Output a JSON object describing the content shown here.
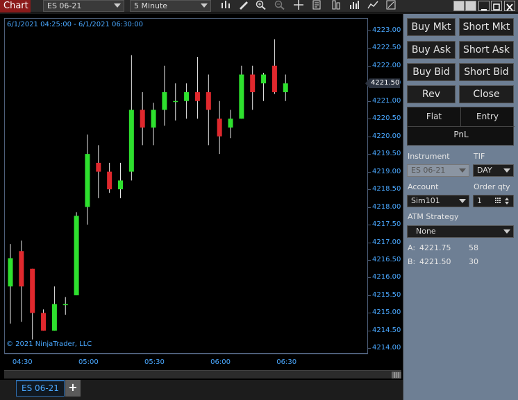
{
  "toolbar": {
    "chart_tab": "Chart",
    "instrument": "ES 06-21",
    "interval": "5 Minute",
    "icons": [
      "bars-type-icon",
      "drawing-tool-icon",
      "zoom-in-icon",
      "zoom-out-icon",
      "crosshair-icon",
      "properties-icon",
      "strategies-icon",
      "indicators-icon",
      "chart-trader-icon",
      "snapshot-icon"
    ]
  },
  "chart": {
    "range_label": "6/1/2021 04:25:00 - 6/1/2021 06:30:00",
    "copyright": "© 2021 NinjaTrader, LLC",
    "current_price": "4221.50",
    "y_ticks": [
      "4223.00",
      "4222.50",
      "4222.00",
      "4221.50",
      "4221.00",
      "4220.50",
      "4220.00",
      "4219.50",
      "4219.00",
      "4218.50",
      "4218.00",
      "4217.50",
      "4217.00",
      "4216.50",
      "4216.00",
      "4215.50",
      "4215.00",
      "4214.50",
      "4214.00"
    ],
    "x_ticks": [
      "04:30",
      "05:00",
      "05:30",
      "06:00",
      "06:30"
    ],
    "colors": {
      "up": "#2ee02e",
      "down": "#e0282d",
      "wick": "#e8e8e8",
      "axis_text": "#4aa8ff"
    }
  },
  "chart_data": {
    "type": "candlestick",
    "x": [
      "04:25",
      "04:30",
      "04:35",
      "04:40",
      "04:45",
      "04:50",
      "04:55",
      "05:00",
      "05:05",
      "05:10",
      "05:15",
      "05:20",
      "05:25",
      "05:30",
      "05:35",
      "05:40",
      "05:45",
      "05:50",
      "05:55",
      "06:00",
      "06:05",
      "06:10",
      "06:15",
      "06:20",
      "06:25",
      "06:30"
    ],
    "ohlc": [
      {
        "o": 4215.75,
        "h": 4216.95,
        "l": 4214.7,
        "c": 4216.55
      },
      {
        "o": 4216.75,
        "h": 4217.05,
        "l": 4214.75,
        "c": 4215.75
      },
      {
        "o": 4216.25,
        "h": 4216.25,
        "l": 4214.25,
        "c": 4215.0
      },
      {
        "o": 4215.0,
        "h": 4215.1,
        "l": 4214.5,
        "c": 4214.5
      },
      {
        "o": 4214.5,
        "h": 4215.75,
        "l": 4214.5,
        "c": 4215.25
      },
      {
        "o": 4215.25,
        "h": 4215.45,
        "l": 4214.95,
        "c": 4215.25
      },
      {
        "o": 4215.5,
        "h": 4217.85,
        "l": 4215.5,
        "c": 4217.75
      },
      {
        "o": 4218.0,
        "h": 4220.05,
        "l": 4217.5,
        "c": 4219.5
      },
      {
        "o": 4219.25,
        "h": 4219.75,
        "l": 4218.25,
        "c": 4219.0
      },
      {
        "o": 4219.0,
        "h": 4219.25,
        "l": 4218.4,
        "c": 4218.5
      },
      {
        "o": 4218.5,
        "h": 4219.25,
        "l": 4218.25,
        "c": 4218.75
      },
      {
        "o": 4219.0,
        "h": 4222.3,
        "l": 4218.75,
        "c": 4220.75
      },
      {
        "o": 4220.75,
        "h": 4221.25,
        "l": 4219.75,
        "c": 4220.25
      },
      {
        "o": 4220.25,
        "h": 4220.95,
        "l": 4219.75,
        "c": 4220.75
      },
      {
        "o": 4220.75,
        "h": 4222.0,
        "l": 4220.3,
        "c": 4221.25
      },
      {
        "o": 4221.0,
        "h": 4221.5,
        "l": 4220.45,
        "c": 4221.0
      },
      {
        "o": 4221.0,
        "h": 4221.5,
        "l": 4220.5,
        "c": 4221.25
      },
      {
        "o": 4221.25,
        "h": 4222.25,
        "l": 4220.5,
        "c": 4221.0
      },
      {
        "o": 4221.25,
        "h": 4221.75,
        "l": 4219.75,
        "c": 4220.75
      },
      {
        "o": 4220.5,
        "h": 4221.0,
        "l": 4219.5,
        "c": 4220.0
      },
      {
        "o": 4220.25,
        "h": 4220.75,
        "l": 4219.95,
        "c": 4220.5
      },
      {
        "o": 4220.5,
        "h": 4222.0,
        "l": 4220.5,
        "c": 4221.75
      },
      {
        "o": 4221.75,
        "h": 4222.0,
        "l": 4220.75,
        "c": 4221.25
      },
      {
        "o": 4221.5,
        "h": 4221.8,
        "l": 4221.0,
        "c": 4221.75
      },
      {
        "o": 4222.0,
        "h": 4222.75,
        "l": 4221.2,
        "c": 4221.25
      },
      {
        "o": 4221.25,
        "h": 4221.75,
        "l": 4221.0,
        "c": 4221.5
      }
    ],
    "ylim": [
      4213.85,
      4223.35
    ],
    "title": "",
    "xlabel": "",
    "ylabel": ""
  },
  "bottom": {
    "instrument_tab": "ES 06-21",
    "add_tab": "+"
  },
  "panel": {
    "buy_mkt": "Buy Mkt",
    "short_mkt": "Short Mkt",
    "buy_ask": "Buy Ask",
    "short_ask": "Short Ask",
    "buy_bid": "Buy Bid",
    "short_bid": "Short Bid",
    "rev": "Rev",
    "close": "Close",
    "flat": "Flat",
    "entry": "Entry",
    "pnl": "PnL",
    "instrument_label": "Instrument",
    "instrument_value": "ES 06-21",
    "tif_label": "TIF",
    "tif_value": "DAY",
    "account_label": "Account",
    "account_value": "Sim101",
    "order_qty_label": "Order qty",
    "order_qty_value": "1",
    "atm_label": "ATM Strategy",
    "atm_value": "None",
    "ask_label": "A:",
    "ask_price": "4221.75",
    "ask_size": "58",
    "bid_label": "B:",
    "bid_price": "4221.50",
    "bid_size": "30",
    "colors": {
      "panel_bg": "#6e7f94",
      "button_bg": "#1e1e1e"
    }
  }
}
